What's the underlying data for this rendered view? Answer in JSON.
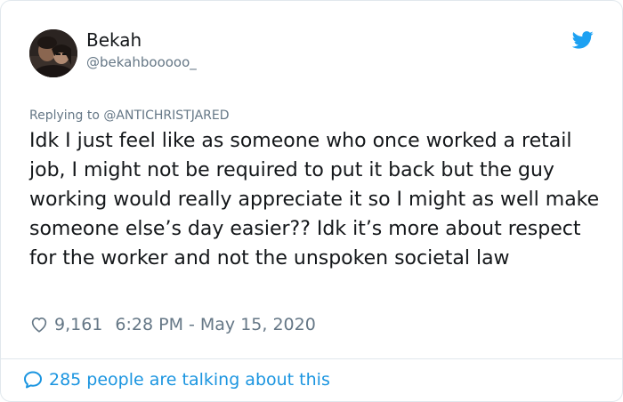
{
  "tweet": {
    "author": {
      "display_name": "Bekah",
      "handle": "@bekahbooooo_"
    },
    "replying_to": {
      "prefix": "Replying to",
      "mention": "@ANTICHRISTJARED"
    },
    "text": "Idk I just feel like as someone who once worked a retail job, I might not be required to put it back but the guy working would really appreciate it so I might as well make someone else’s day easier?? Idk it’s more about respect for the worker and not the unspoken societal law",
    "likes": "9,161",
    "timestamp": "6:28 PM - May 15, 2020",
    "talking": "285 people are talking about this"
  },
  "icons": {
    "brand": "twitter-bird-icon",
    "like": "heart-outline-icon",
    "conversation": "speech-bubble-icon"
  },
  "colors": {
    "brand_blue": "#1da1f2",
    "link_blue": "#1b95e0",
    "text_primary": "#14171a",
    "text_secondary": "#657786",
    "border": "#e1e8ed"
  }
}
